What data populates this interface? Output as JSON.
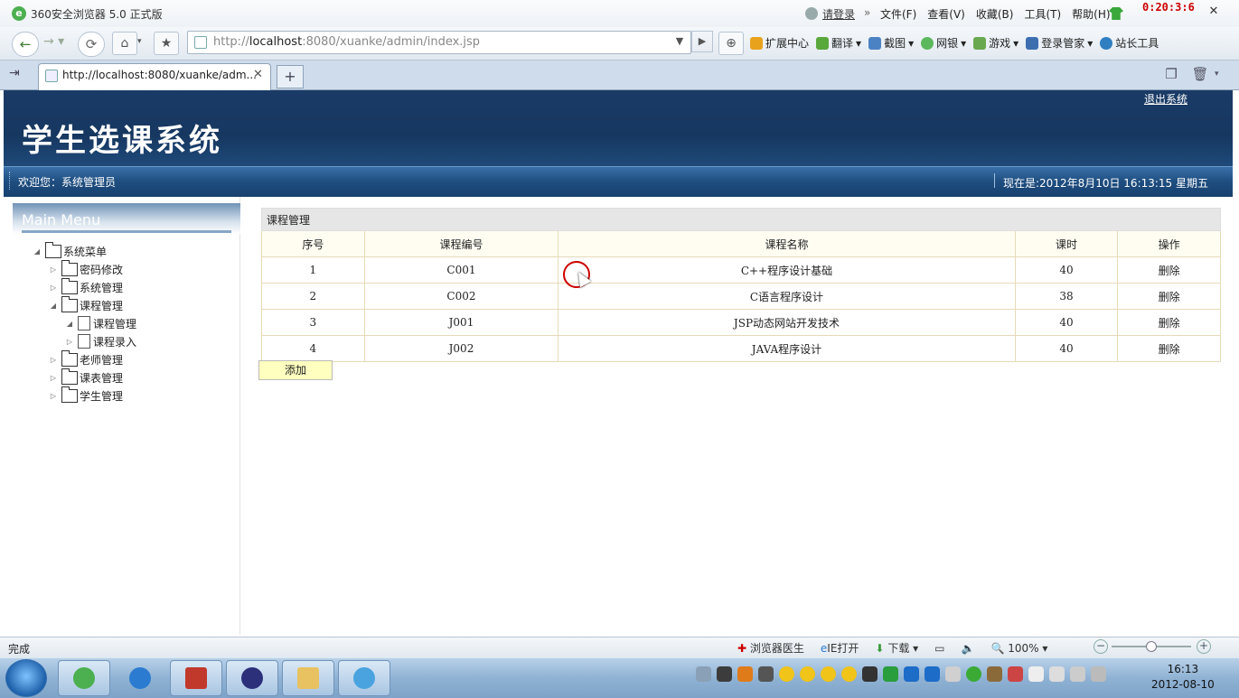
{
  "browser": {
    "title": "360安全浏览器 5.0 正式版",
    "login_link": "请登录",
    "menu": [
      "文件(F)",
      "查看(V)",
      "收藏(B)",
      "工具(T)",
      "帮助(H)"
    ],
    "timer": "0:20:3:6",
    "address_prefix": "http://",
    "address_host": "localhost",
    "address_rest": ":8080/xuanke/admin/index.jsp",
    "toolbar": [
      "扩展中心",
      "翻译",
      "截图",
      "网银",
      "游戏",
      "登录管家",
      "站长工具"
    ],
    "tab_title": "http://localhost:8080/xuanke/adm...",
    "status": "完成",
    "status_items": [
      "浏览器医生",
      "IE打开",
      "下载",
      "100%"
    ]
  },
  "page": {
    "site_title": "学生选课系统",
    "logout": "退出系统",
    "welcome": "欢迎您：系统管理员",
    "clock": "现在是:2012年8月10日  16:13:15 星期五"
  },
  "sidebar": {
    "header": "Main Menu",
    "tree": [
      {
        "label": "系统菜单",
        "level": 0,
        "expanded": true,
        "type": "folder"
      },
      {
        "label": "密码修改",
        "level": 1,
        "expanded": false,
        "type": "folder"
      },
      {
        "label": "系统管理",
        "level": 1,
        "expanded": false,
        "type": "folder"
      },
      {
        "label": "课程管理",
        "level": 1,
        "expanded": true,
        "type": "folder"
      },
      {
        "label": "课程管理",
        "level": 2,
        "expanded": true,
        "type": "page"
      },
      {
        "label": "课程录入",
        "level": 2,
        "expanded": false,
        "type": "page"
      },
      {
        "label": "老师管理",
        "level": 1,
        "expanded": false,
        "type": "folder"
      },
      {
        "label": "课表管理",
        "level": 1,
        "expanded": false,
        "type": "folder"
      },
      {
        "label": "学生管理",
        "level": 1,
        "expanded": false,
        "type": "folder"
      }
    ]
  },
  "table": {
    "caption": "课程管理",
    "columns": [
      "序号",
      "课程编号",
      "课程名称",
      "课时",
      "操作"
    ],
    "rows": [
      [
        "1",
        "C001",
        "C++程序设计基础",
        "40",
        "删除"
      ],
      [
        "2",
        "C002",
        "C语言程序设计",
        "38",
        "删除"
      ],
      [
        "3",
        "J001",
        "JSP动态网站开发技术",
        "40",
        "删除"
      ],
      [
        "4",
        "J002",
        "JAVA程序设计",
        "40",
        "删除"
      ]
    ],
    "add_label": "添加"
  },
  "taskbar": {
    "time": "16:13",
    "date": "2012-08-10"
  },
  "colors": {
    "header_bg": "#163760",
    "add_button_bg": "#ffffc0",
    "timer_red": "#cc0000"
  }
}
